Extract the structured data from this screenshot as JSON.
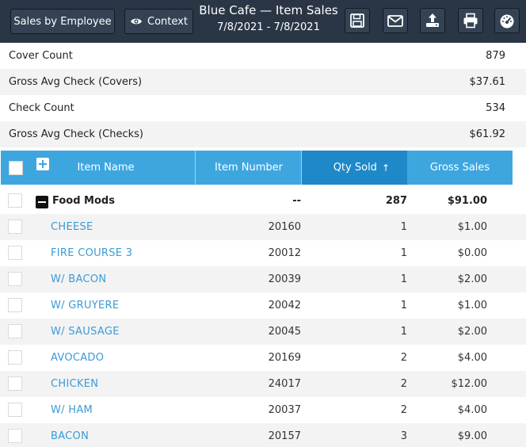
{
  "header": {
    "sales_by_employee_label": "Sales by Employee",
    "context_label": "Context",
    "title": "Blue Cafe — Item Sales",
    "date_range": "7/8/2021 - 7/8/2021",
    "icons": [
      "save-icon",
      "email-icon",
      "export-icon",
      "print-icon",
      "dashboard-icon"
    ]
  },
  "summary": [
    {
      "label": "Cover Count",
      "value": "879"
    },
    {
      "label": "Gross Avg Check (Covers)",
      "value": "$37.61"
    },
    {
      "label": "Check Count",
      "value": "534"
    },
    {
      "label": "Gross Avg Check (Checks)",
      "value": "$61.92"
    }
  ],
  "table": {
    "columns": {
      "item_name": "Item Name",
      "item_number": "Item Number",
      "qty_sold": "Qty Sold",
      "gross_sales": "Gross Sales"
    },
    "sort_indicator": "↑",
    "group": {
      "name": "Food Mods",
      "item_number": "--",
      "qty": "287",
      "gross": "$91.00"
    },
    "rows": [
      {
        "name": "CHEESE",
        "number": "20160",
        "qty": "1",
        "gross": "$1.00"
      },
      {
        "name": "FIRE COURSE 3",
        "number": "20012",
        "qty": "1",
        "gross": "$0.00"
      },
      {
        "name": "W/ BACON",
        "number": "20039",
        "qty": "1",
        "gross": "$2.00"
      },
      {
        "name": "W/ GRUYERE",
        "number": "20042",
        "qty": "1",
        "gross": "$1.00"
      },
      {
        "name": "W/ SAUSAGE",
        "number": "20045",
        "qty": "1",
        "gross": "$2.00"
      },
      {
        "name": "AVOCADO",
        "number": "20169",
        "qty": "2",
        "gross": "$4.00"
      },
      {
        "name": "CHICKEN",
        "number": "24017",
        "qty": "2",
        "gross": "$12.00"
      },
      {
        "name": "W/ HAM",
        "number": "20037",
        "qty": "2",
        "gross": "$4.00"
      },
      {
        "name": "BACON",
        "number": "20157",
        "qty": "3",
        "gross": "$9.00"
      }
    ]
  },
  "colors": {
    "header_bg": "#2a3646",
    "table_header": "#3ea6df",
    "sorted_column": "#1e88c8",
    "link_text": "#3a9bd6"
  }
}
